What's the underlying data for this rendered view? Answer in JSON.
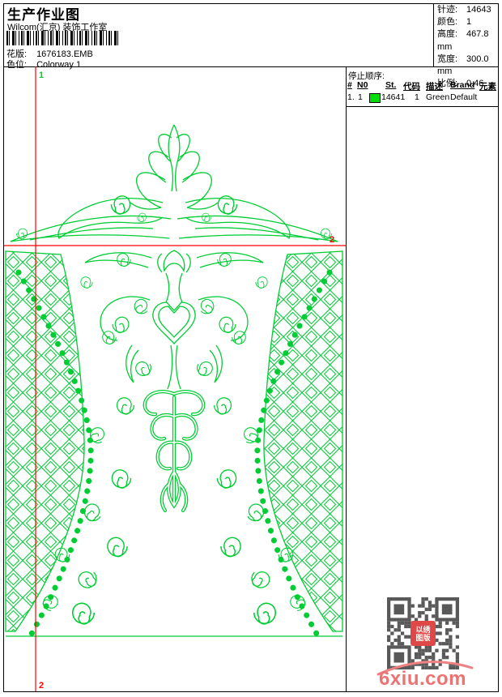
{
  "header": {
    "title": "生产作业图",
    "studio": "Wilcom(汇京) 装饰工作室",
    "pattern_label": "花版:",
    "pattern_value": "1676183.EMB",
    "colorway_label": "色位:",
    "colorway_value": "Colorway 1",
    "stats": [
      {
        "label": "针迹:",
        "value": "14643"
      },
      {
        "label": "颜色:",
        "value": "1"
      },
      {
        "label": "高度:",
        "value": "467.8 mm"
      },
      {
        "label": "宽度:",
        "value": "300.0 mm"
      },
      {
        "label": "比例:",
        "value": "0.46"
      }
    ]
  },
  "stop_sequence": {
    "title": "停止顺序:",
    "columns": [
      "#",
      "N0",
      "St.",
      "代码",
      "描述",
      "Brand",
      "元素"
    ],
    "row": {
      "index": "1.",
      "needle": "1",
      "chip_color": "#00dd00",
      "stitches": "14641",
      "code": "1",
      "description": "Green",
      "brand": "Default",
      "element": ""
    }
  },
  "design": {
    "marker_top": "1",
    "marker_hline_right": "2",
    "marker_bottom": "2",
    "art_color": "#00cc33",
    "guide_color": "#ff0000"
  },
  "footer": {
    "watermark": "6xiu.com",
    "stamp_top": "以绣",
    "stamp_bottom": "图版",
    "qr_color": "#595959"
  }
}
